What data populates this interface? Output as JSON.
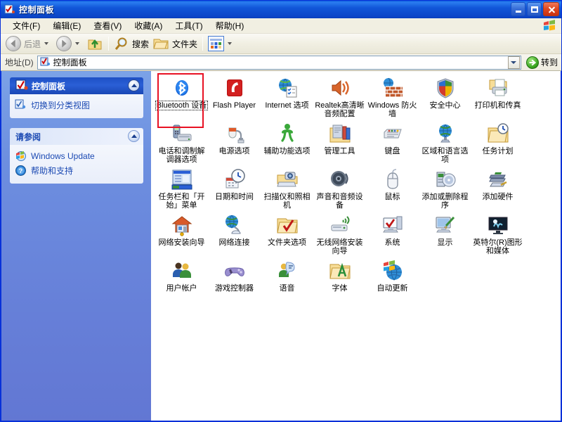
{
  "window": {
    "title": "控制面板",
    "title_icon": "control-panel-icon",
    "buttons": {
      "minimize": "最小化",
      "maximize": "最大化",
      "close": "关闭"
    }
  },
  "menubar": {
    "items": [
      {
        "label": "文件(F)"
      },
      {
        "label": "编辑(E)"
      },
      {
        "label": "查看(V)"
      },
      {
        "label": "收藏(A)"
      },
      {
        "label": "工具(T)"
      },
      {
        "label": "帮助(H)"
      }
    ]
  },
  "toolbar": {
    "back": "后退",
    "forward": "",
    "up": "",
    "search": "搜索",
    "folders": "文件夹",
    "views": ""
  },
  "addressbar": {
    "label": "地址(D)",
    "value": "控制面板",
    "go": "转到"
  },
  "sidebar": {
    "panels": [
      {
        "title": "控制面板",
        "style": "blue",
        "icon": "control-panel-icon",
        "links": [
          {
            "label": "切换到分类视图",
            "icon": "category-view-icon"
          }
        ]
      },
      {
        "title": "请参阅",
        "style": "light",
        "icon": "",
        "links": [
          {
            "label": "Windows Update",
            "icon": "windows-update-icon"
          },
          {
            "label": "帮助和支持",
            "icon": "help-icon"
          }
        ]
      }
    ]
  },
  "content": {
    "highlight_index": 0,
    "items": [
      {
        "label": "Bluetooth 设备",
        "icon": "bluetooth-icon",
        "focused": true
      },
      {
        "label": "Flash Player",
        "icon": "flash-player-icon",
        "focused": false
      },
      {
        "label": "Internet 选项",
        "icon": "internet-options-icon",
        "focused": false
      },
      {
        "label": "Realtek高清晰音频配置",
        "icon": "realtek-audio-icon",
        "focused": false
      },
      {
        "label": "Windows 防火墙",
        "icon": "windows-firewall-icon",
        "focused": false
      },
      {
        "label": "安全中心",
        "icon": "security-center-icon",
        "focused": false
      },
      {
        "label": "打印机和传真",
        "icon": "printers-and-faxes-icon",
        "focused": false
      },
      {
        "label": "电话和调制解调器选项",
        "icon": "phone-and-modem-icon",
        "focused": false
      },
      {
        "label": "电源选项",
        "icon": "power-options-icon",
        "focused": false
      },
      {
        "label": "辅助功能选项",
        "icon": "accessibility-icon",
        "focused": false
      },
      {
        "label": "管理工具",
        "icon": "administrative-tools-icon",
        "focused": false
      },
      {
        "label": "键盘",
        "icon": "keyboard-icon",
        "focused": false
      },
      {
        "label": "区域和语言选项",
        "icon": "regional-language-icon",
        "focused": false
      },
      {
        "label": "任务计划",
        "icon": "scheduled-tasks-icon",
        "focused": false
      },
      {
        "label": "任务栏和「开始」菜单",
        "icon": "taskbar-start-menu-icon",
        "focused": false
      },
      {
        "label": "日期和时间",
        "icon": "date-and-time-icon",
        "focused": false
      },
      {
        "label": "扫描仪和照相机",
        "icon": "scanners-cameras-icon",
        "focused": false
      },
      {
        "label": "声音和音频设备",
        "icon": "sounds-audio-icon",
        "focused": false
      },
      {
        "label": "鼠标",
        "icon": "mouse-icon",
        "focused": false
      },
      {
        "label": "添加或删除程序",
        "icon": "add-remove-programs-icon",
        "focused": false
      },
      {
        "label": "添加硬件",
        "icon": "add-hardware-icon",
        "focused": false
      },
      {
        "label": "网络安装向导",
        "icon": "network-setup-wizard-icon",
        "focused": false
      },
      {
        "label": "网络连接",
        "icon": "network-connections-icon",
        "focused": false
      },
      {
        "label": "文件夹选项",
        "icon": "folder-options-icon",
        "focused": false
      },
      {
        "label": "无线网络安装向导",
        "icon": "wireless-network-wizard-icon",
        "focused": false
      },
      {
        "label": "系统",
        "icon": "system-icon",
        "focused": false
      },
      {
        "label": "显示",
        "icon": "display-icon",
        "focused": false
      },
      {
        "label": "英特尔(R)图形和媒体",
        "icon": "intel-graphics-icon",
        "focused": false
      },
      {
        "label": "用户帐户",
        "icon": "user-accounts-icon",
        "focused": false
      },
      {
        "label": "游戏控制器",
        "icon": "game-controllers-icon",
        "focused": false
      },
      {
        "label": "语音",
        "icon": "speech-icon",
        "focused": false
      },
      {
        "label": "字体",
        "icon": "fonts-icon",
        "focused": false
      },
      {
        "label": "自动更新",
        "icon": "automatic-updates-icon",
        "focused": false
      }
    ]
  },
  "colors": {
    "titlebar_blue": "#0a44d4",
    "sidebar_blue": "#6d8fe0",
    "highlight_red": "#e81123",
    "link_blue": "#1c4ab3"
  }
}
